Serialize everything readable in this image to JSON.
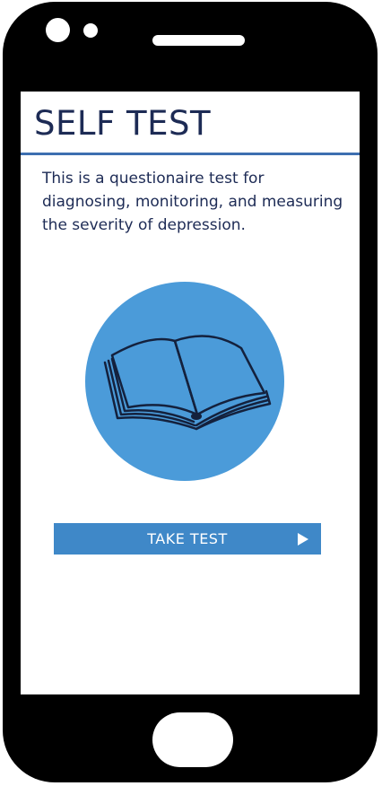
{
  "header": {
    "title": "SELF TEST"
  },
  "main": {
    "description": "This is a questionaire test for diagnosing, monitoring, and measuring the severity of depression.",
    "illustration_icon": "open-book-icon",
    "take_test_label": "TAKE TEST",
    "take_test_icon": "play-arrow-icon"
  },
  "colors": {
    "title_text": "#1d2b55",
    "accent_rule": "#3d6fb0",
    "circle": "#4b9bd9",
    "button": "#3f88c8",
    "device_frame": "#000000"
  }
}
